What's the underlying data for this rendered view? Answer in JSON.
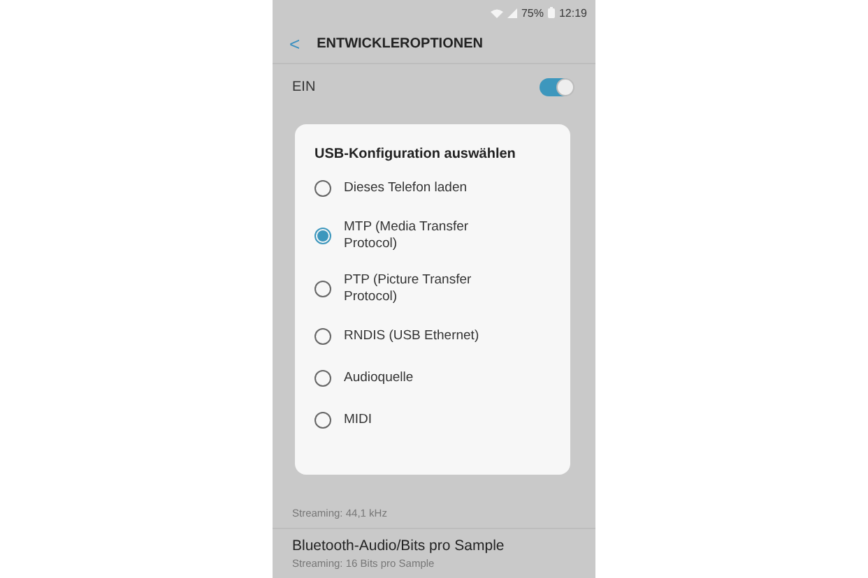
{
  "status_bar": {
    "battery": "75%",
    "time": "12:19"
  },
  "header": {
    "back": "<",
    "title": "ENTWICKLEROPTIONEN"
  },
  "master_switch": {
    "label": "EIN",
    "on": true
  },
  "settings": [
    {
      "subtitle": "Streaming: 44,1 kHz"
    },
    {
      "title": "Bluetooth-Audio/Bits pro Sample",
      "subtitle": "Streaming: 16 Bits pro Sample"
    }
  ],
  "dialog": {
    "title": "USB-Konfiguration auswählen",
    "options": [
      {
        "label": "Dieses Telefon laden",
        "selected": false
      },
      {
        "label": "MTP (Media Transfer Protocol)",
        "selected": true
      },
      {
        "label": "PTP (Picture Transfer Protocol)",
        "selected": false
      },
      {
        "label": "RNDIS (USB Ethernet)",
        "selected": false
      },
      {
        "label": "Audioquelle",
        "selected": false
      },
      {
        "label": "MIDI",
        "selected": false
      }
    ]
  }
}
